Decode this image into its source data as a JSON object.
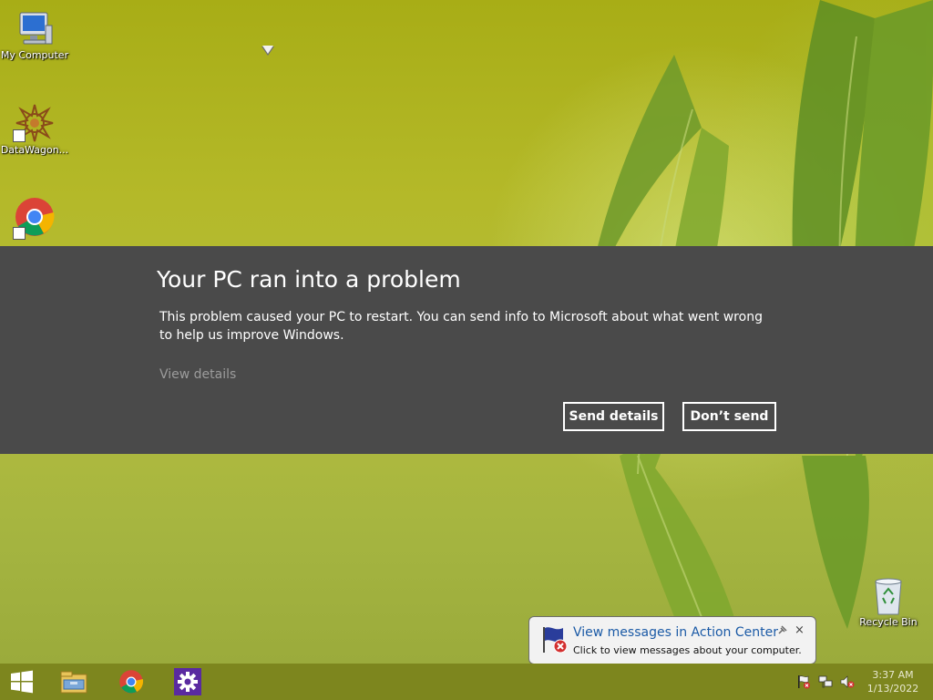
{
  "desktop": {
    "icons": [
      {
        "label": "My Computer",
        "icon": "computer-icon"
      },
      {
        "label": "DataWagon...",
        "icon": "datawagon-icon"
      },
      {
        "label": "",
        "icon": "chrome-icon"
      },
      {
        "label": "Recycle Bin",
        "icon": "recycle-bin-icon"
      }
    ]
  },
  "dialog": {
    "title": "Your PC ran into a problem",
    "message": "This problem caused your PC to restart. You can send info to Microsoft about what went wrong to help us improve Windows.",
    "view_details": "View details",
    "send_button": "Send details",
    "dont_send_button": "Don’t send"
  },
  "balloon": {
    "title": "View messages in Action Center",
    "text": "Click to view messages about your computer.",
    "close": "×",
    "icon": "action-center-flag-icon"
  },
  "taskbar": {
    "items": [
      "start-icon",
      "file-explorer-icon",
      "chrome-icon",
      "settings-icon"
    ],
    "tray": [
      "action-center-flag-icon",
      "network-icon",
      "volume-muted-icon"
    ],
    "time": "3:37 AM",
    "date": "1/13/2022"
  },
  "colors": {
    "dialog_bg": "#4a4a4a",
    "accent_link": "#1b5aa6",
    "taskbar": "#7d861e"
  }
}
